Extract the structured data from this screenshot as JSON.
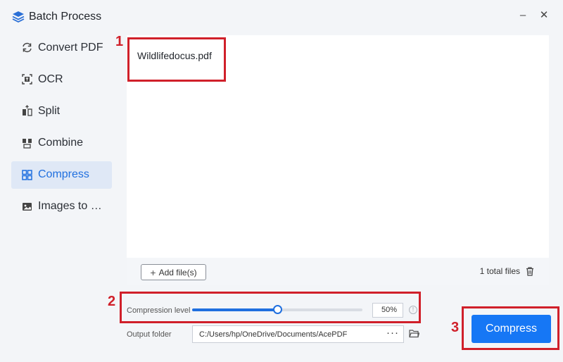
{
  "window": {
    "title": "Batch Process",
    "minimize": "–",
    "close": "✕"
  },
  "sidebar": {
    "items": [
      {
        "label": "Convert PDF",
        "icon": "convert-icon",
        "active": false
      },
      {
        "label": "OCR",
        "icon": "ocr-icon",
        "active": false
      },
      {
        "label": "Split",
        "icon": "split-icon",
        "active": false
      },
      {
        "label": "Combine",
        "icon": "combine-icon",
        "active": false
      },
      {
        "label": "Compress",
        "icon": "compress-icon",
        "active": true
      },
      {
        "label": "Images to …",
        "icon": "images-icon",
        "active": false
      }
    ]
  },
  "files": {
    "items": [
      "Wildlifedocus.pdf"
    ],
    "add_label": "Add file(s)",
    "total_label": "1 total files"
  },
  "compression": {
    "label": "Compression level",
    "value_percent": 50,
    "value_text": "50%"
  },
  "output": {
    "label": "Output folder",
    "path": "C:/Users/hp/OneDrive/Documents/AcePDF",
    "browse_label": "···"
  },
  "actions": {
    "compress_label": "Compress"
  },
  "annotations": {
    "colors": {
      "accent": "#d0202a"
    },
    "labels": [
      "1",
      "2",
      "3"
    ]
  },
  "colors": {
    "primary": "#1677f5",
    "active_bg": "#dfe8f6",
    "active_text": "#1f6fdf"
  }
}
